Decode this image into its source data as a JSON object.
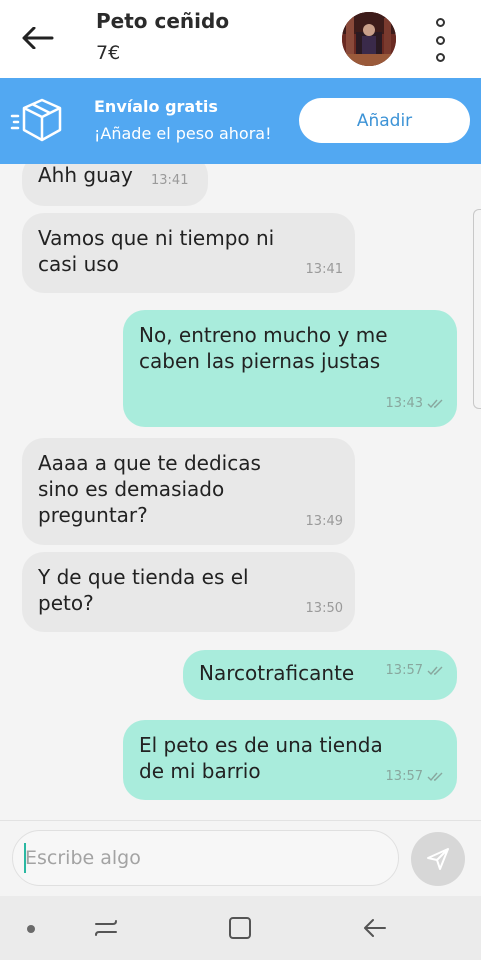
{
  "header": {
    "title": "Peto ceñido",
    "price": "7€"
  },
  "banner": {
    "title": "Envíalo gratis",
    "subtitle": "¡Añade el peso ahora!",
    "button_label": "Añadir"
  },
  "messages": [
    {
      "side": "in",
      "text": "Ahh guay",
      "time": "13:41"
    },
    {
      "side": "in",
      "text": "Vamos que ni tiempo ni\ncasi uso",
      "time": "13:41"
    },
    {
      "side": "out",
      "text": "No, entreno mucho y me\ncaben las piernas justas",
      "time": "13:43",
      "status": "read"
    },
    {
      "side": "in",
      "text": "Aaaa a que te dedicas\nsino es demasiado\npreguntar?",
      "time": "13:49"
    },
    {
      "side": "in",
      "text": "Y de que tienda es el\npeto?",
      "time": "13:50"
    },
    {
      "side": "out",
      "text": "Narcotraficante",
      "time": "13:57",
      "status": "read"
    },
    {
      "side": "out",
      "text": "El peto es de una tienda\nde mi barrio",
      "time": "13:57",
      "status": "read"
    }
  ],
  "composer": {
    "placeholder": "Escribe algo"
  },
  "colors": {
    "banner": "#52a8f2",
    "outgoing_bubble": "#a9ecdc",
    "incoming_bubble": "#e8e8e8"
  },
  "icons": [
    "back-arrow-icon",
    "kebab-menu-icon",
    "box-icon",
    "send-icon",
    "recent-apps-icon",
    "home-icon",
    "back-icon"
  ]
}
